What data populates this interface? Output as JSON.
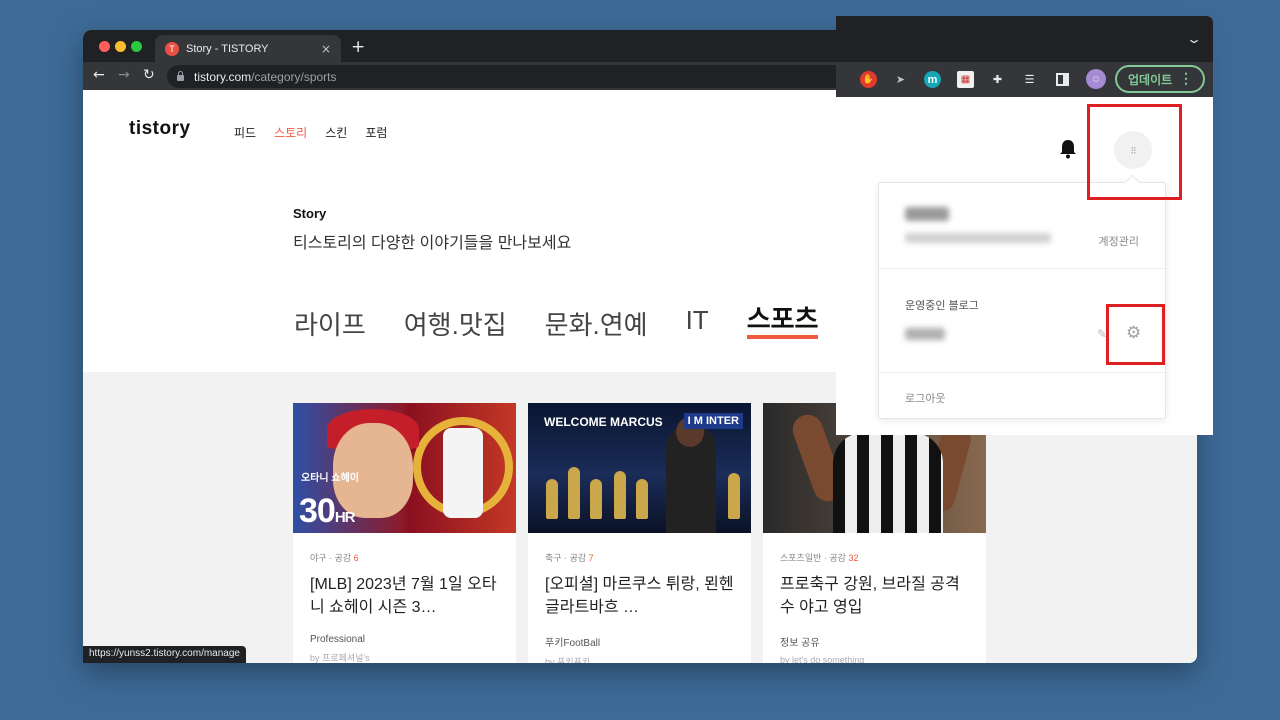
{
  "browser": {
    "tab_title": "Story - TISTORY",
    "tab_favicon": "T",
    "new_tab": "+",
    "close_tab": "×",
    "url_host": "tistory.com",
    "url_path": "/category/sports",
    "status_url": "https://yunss2.tistory.com/manage"
  },
  "site": {
    "logo": "tistory",
    "nav": [
      "피드",
      "스토리",
      "스킨",
      "포럼"
    ],
    "nav_active": "스토리",
    "story_title": "Story",
    "story_subtitle": "티스토리의 다양한 이야기들을 만나보세요",
    "categories": [
      "라이프",
      "여행.맛집",
      "문화.연예",
      "IT",
      "스포츠"
    ],
    "selected_category": "스포츠"
  },
  "cards": [
    {
      "category": "야구",
      "likes_label": "공감",
      "likes": "6",
      "title": "[MLB] 2023년 7월 1일 오타니 쇼헤이 시즌 3…",
      "blog": "Professional",
      "author": "by 프로페셔널's",
      "thumb_text_name": "오타니 쇼헤이",
      "thumb_text_hr": "30",
      "thumb_text_hr_suffix": "HR"
    },
    {
      "category": "축구",
      "likes_label": "공감",
      "likes": "7",
      "title": "[오피셜] 마르쿠스 튀랑, 묀헨글라트바흐 …",
      "blog": "푸키FootBall",
      "author": "by 푸키푸키",
      "thumb_text_welcome": "WELCOME MARCUS",
      "thumb_text_inter": "I M INTER"
    },
    {
      "category": "스포츠일반",
      "likes_label": "공감",
      "likes": "32",
      "title": "프로축구 강원, 브라질 공격수 야고 영입",
      "blog": "정보 공유",
      "author": "by let's do something"
    }
  ],
  "overlay": {
    "update_button": "업데이트",
    "account_manage": "계정관리",
    "running_blogs": "운영중인 블로그",
    "logout": "로그아웃"
  },
  "icons": {
    "back": "arrow-left-icon",
    "forward": "arrow-right-icon",
    "reload": "reload-icon",
    "bell": "bell-icon",
    "gear": "gear-icon",
    "pencil": "pencil-icon"
  },
  "colors": {
    "accent": "#ef5a3f",
    "highlight": "#e02020",
    "background": "#3d6b97",
    "update_green": "#81c995"
  }
}
